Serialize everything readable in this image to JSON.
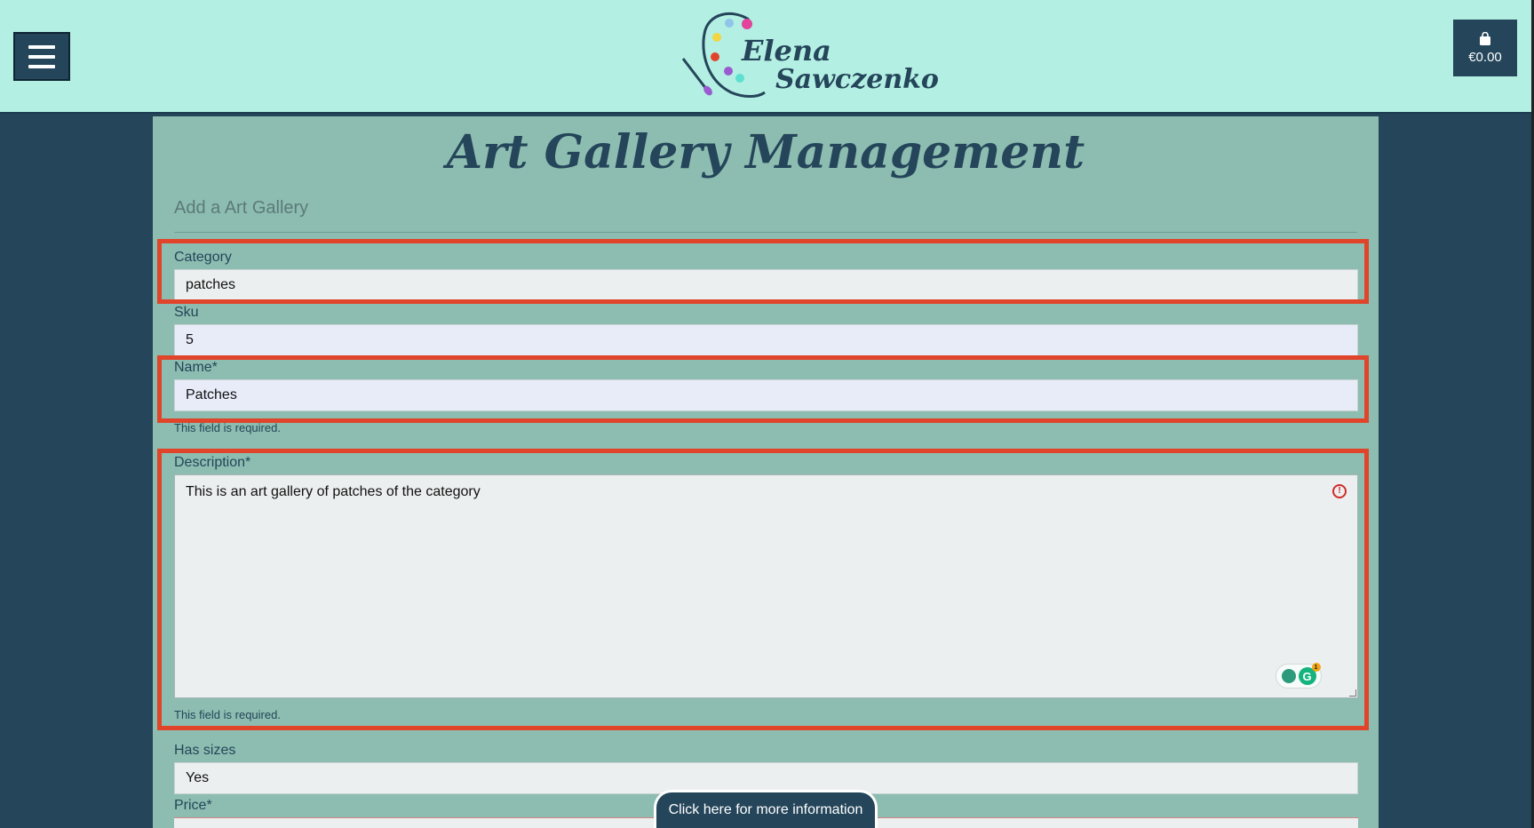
{
  "header": {
    "logo_line1": "Elena",
    "logo_line2": "Sawczenko",
    "cart_amount": "€0.00",
    "menu_icon": "hamburger-icon",
    "cart_icon": "shopping-bag-icon"
  },
  "page": {
    "title": "Art Gallery Management",
    "subtitle": "Add a Art Gallery"
  },
  "form": {
    "category": {
      "label": "Category",
      "value": "patches"
    },
    "sku": {
      "label": "Sku",
      "value": "5"
    },
    "name": {
      "label": "Name*",
      "value": "Patches",
      "help": "This field is required."
    },
    "description": {
      "label": "Description*",
      "value": "This is an art gallery of patches of the category",
      "help": "This field is required."
    },
    "has_sizes": {
      "label": "Has sizes",
      "value": "Yes"
    },
    "price": {
      "label": "Price*"
    }
  },
  "footer": {
    "info_button": "Click here for more information"
  },
  "colors": {
    "header_bg": "#b4efe3",
    "page_bg": "#24455a",
    "panel_bg": "#8dbdb0",
    "highlight": "#e0442b"
  }
}
